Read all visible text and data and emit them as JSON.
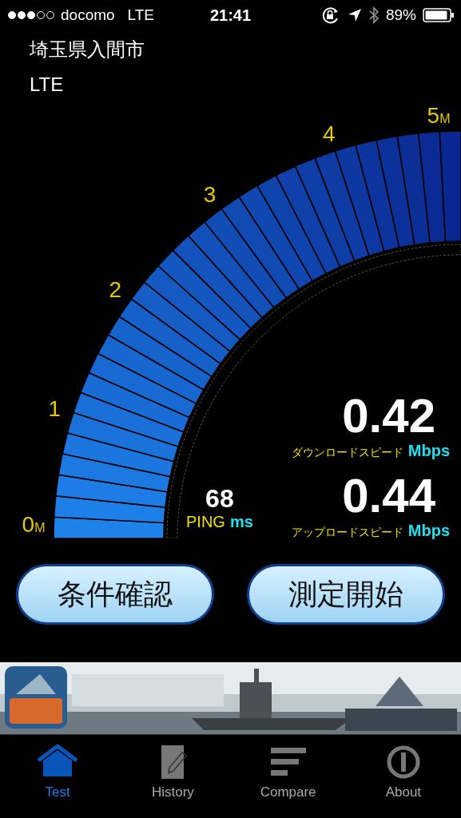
{
  "status_bar": {
    "carrier": "docomo",
    "network": "LTE",
    "time": "21:41",
    "battery": "89%"
  },
  "location": "埼玉県入間市",
  "connection": "LTE",
  "gauge": {
    "scale": [
      {
        "value": "0",
        "unit": "M"
      },
      {
        "value": "1"
      },
      {
        "value": "2"
      },
      {
        "value": "3"
      },
      {
        "value": "4"
      },
      {
        "value": "5",
        "unit": "M"
      }
    ]
  },
  "download": {
    "value": "0.42",
    "label": "ダウンロードスピード",
    "unit": "Mbps"
  },
  "upload": {
    "value": "0.44",
    "label": "アップロードスピード",
    "unit": "Mbps"
  },
  "ping": {
    "value": "68",
    "label": "PING",
    "unit": "ms"
  },
  "buttons": [
    "条件確認",
    "測定開始"
  ],
  "tabs": [
    {
      "label": "Test",
      "kind": "home",
      "selected": true
    },
    {
      "label": "History",
      "kind": "note",
      "selected": false
    },
    {
      "label": "Compare",
      "kind": "bars",
      "selected": false
    },
    {
      "label": "About",
      "kind": "info",
      "selected": false
    }
  ]
}
